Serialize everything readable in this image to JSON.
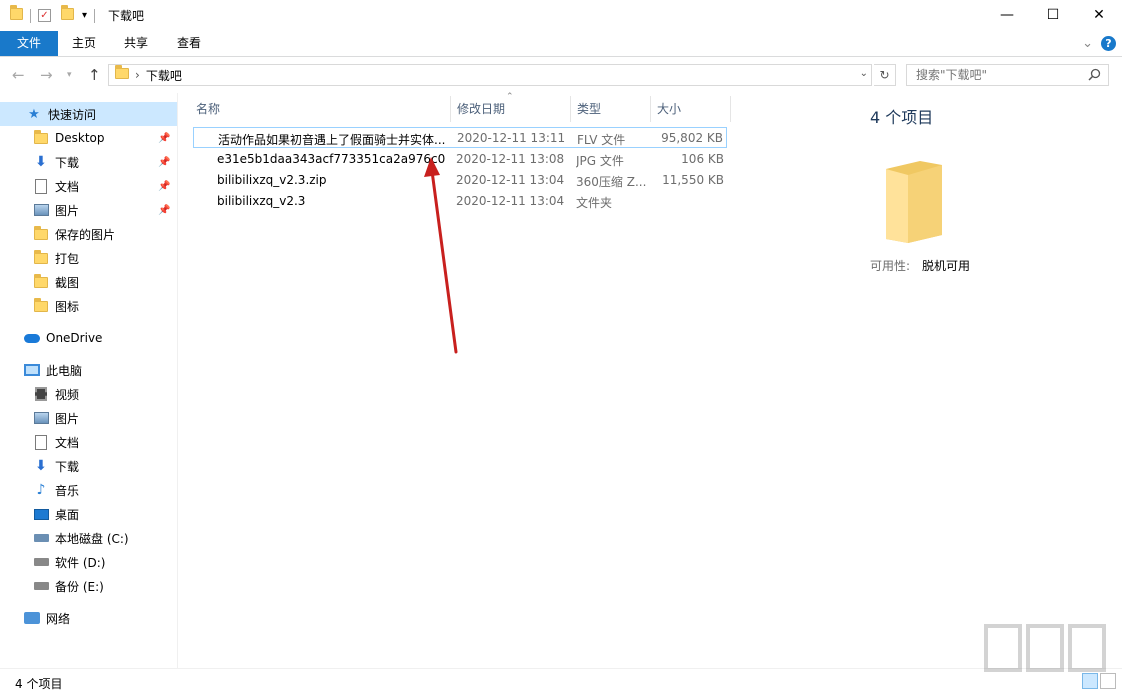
{
  "window": {
    "title": "下载吧",
    "quick_access_dropdown": "▾",
    "controls": {
      "minimize": "—",
      "maximize": "☐",
      "close": "✕"
    }
  },
  "ribbon": {
    "tabs": [
      {
        "label": "文件",
        "active": true
      },
      {
        "label": "主页"
      },
      {
        "label": "共享"
      },
      {
        "label": "查看"
      }
    ],
    "expand_glyph": "⌄",
    "help_glyph": "?"
  },
  "address": {
    "separator": "›",
    "breadcrumb": "下载吧",
    "search_placeholder": "搜索\"下载吧\""
  },
  "nav": {
    "quick_access": "快速访问",
    "quick_items": [
      {
        "label": "Desktop",
        "icon": "folder-icon",
        "pinned": true
      },
      {
        "label": "下载",
        "icon": "download-arrow-icon",
        "pinned": true
      },
      {
        "label": "文档",
        "icon": "document-icon",
        "pinned": true
      },
      {
        "label": "图片",
        "icon": "picture-icon",
        "pinned": true
      },
      {
        "label": "保存的图片",
        "icon": "folder-icon"
      },
      {
        "label": "打包",
        "icon": "folder-icon"
      },
      {
        "label": "截图",
        "icon": "folder-icon"
      },
      {
        "label": "图标",
        "icon": "folder-icon"
      }
    ],
    "onedrive": "OneDrive",
    "this_pc": "此电脑",
    "pc_items": [
      {
        "label": "视频",
        "icon": "video-icon"
      },
      {
        "label": "图片",
        "icon": "picture-icon"
      },
      {
        "label": "文档",
        "icon": "document-icon"
      },
      {
        "label": "下载",
        "icon": "download-arrow-icon"
      },
      {
        "label": "音乐",
        "icon": "music-note-icon"
      },
      {
        "label": "桌面",
        "icon": "desktop-icon"
      },
      {
        "label": "本地磁盘 (C:)",
        "icon": "system-drive-icon"
      },
      {
        "label": "软件 (D:)",
        "icon": "drive-icon"
      },
      {
        "label": "备份 (E:)",
        "icon": "drive-icon"
      }
    ],
    "network": "网络"
  },
  "columns": {
    "name": "名称",
    "date": "修改日期",
    "type": "类型",
    "size": "大小"
  },
  "files": [
    {
      "name": "活动作品如果初音遇上了假面骑士并实体...",
      "date": "2020-12-11 13:11",
      "type": "FLV 文件",
      "size": "95,802 KB",
      "icon": "flv-file-icon"
    },
    {
      "name": "e31e5b1daa343acf773351ca2a976c0...",
      "date": "2020-12-11 13:08",
      "type": "JPG 文件",
      "size": "106 KB",
      "icon": "jpg-file-icon"
    },
    {
      "name": "bilibilixzq_v2.3.zip",
      "date": "2020-12-11 13:04",
      "type": "360压缩 Z...",
      "size": "11,550 KB",
      "icon": "zip-archive-icon"
    },
    {
      "name": "bilibilixzq_v2.3",
      "date": "2020-12-11 13:04",
      "type": "文件夹",
      "size": "",
      "icon": "folder-icon"
    }
  ],
  "preview": {
    "count": "4 个项目",
    "availability_label": "可用性:",
    "availability_value": "脱机可用"
  },
  "status": {
    "text": "4 个项目"
  },
  "colors": {
    "accent": "#1979ca",
    "selection": "#cce8ff",
    "annotation_arrow": "#c8201e"
  }
}
